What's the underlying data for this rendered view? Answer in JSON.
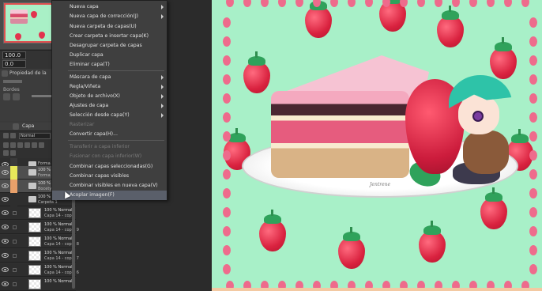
{
  "navigator": {
    "zoom_value": "100.0",
    "rotation_value": "0.0"
  },
  "properties": {
    "tab_label": "Propiedad de la",
    "expression_label": "Bordes"
  },
  "layers": {
    "tab_label": "Capa",
    "blend_mode": "Normal",
    "rows": [
      {
        "kind": "folder",
        "pct": "",
        "name": "Forma",
        "tag": "#3a3a3a"
      },
      {
        "kind": "folder",
        "pct": "100 %",
        "name": "Forma",
        "tag": "#e8e85a"
      },
      {
        "kind": "folder",
        "pct": "100 %",
        "name": "Bocety",
        "tag": "#e8a06a"
      },
      {
        "kind": "folder",
        "pct": "100 %",
        "name": "Carpeta 1",
        "tag": "#2e2e2e"
      },
      {
        "kind": "layer",
        "pct": "100 % Normal",
        "name": "Capa 14 - copia",
        "tag": "#2e2e2e"
      },
      {
        "kind": "layer",
        "pct": "100 % Normal",
        "name": "Capa 14 - copia 9",
        "tag": "#2e2e2e"
      },
      {
        "kind": "layer",
        "pct": "100 % Normal",
        "name": "Capa 14 - copia 8",
        "tag": "#2e2e2e"
      },
      {
        "kind": "layer",
        "pct": "100 % Normal",
        "name": "Capa 14 - copia 7",
        "tag": "#2e2e2e"
      },
      {
        "kind": "layer",
        "pct": "100 % Normal",
        "name": "Capa 14 - copia 6",
        "tag": "#2e2e2e"
      },
      {
        "kind": "layer",
        "pct": "100 % Normal",
        "name": "",
        "tag": "#2e2e2e"
      }
    ]
  },
  "menu": {
    "items": [
      {
        "label": "Nueva capa",
        "submenu": true,
        "disabled": false
      },
      {
        "label": "Nueva capa de corrección(J)",
        "submenu": true,
        "disabled": false
      },
      {
        "label": "Nueva carpeta de capas(U)",
        "submenu": false,
        "disabled": false
      },
      {
        "label": "Crear carpeta e insertar capa(K)",
        "submenu": false,
        "disabled": false
      },
      {
        "label": "Desagrupar carpeta de capas",
        "submenu": false,
        "disabled": false
      },
      {
        "label": "Duplicar capa",
        "submenu": false,
        "disabled": false
      },
      {
        "label": "Eliminar capa(T)",
        "submenu": false,
        "disabled": false
      },
      {
        "label": "Máscara de capa",
        "submenu": true,
        "disabled": false
      },
      {
        "label": "Regla/Viñeta",
        "submenu": true,
        "disabled": false
      },
      {
        "label": "Objeto de archivo(X)",
        "submenu": true,
        "disabled": false
      },
      {
        "label": "Ajustes de capa",
        "submenu": true,
        "disabled": false
      },
      {
        "label": "Selección desde capa(Y)",
        "submenu": true,
        "disabled": false
      },
      {
        "label": "Rasterizar",
        "submenu": false,
        "disabled": true
      },
      {
        "label": "Convertir capa(H)...",
        "submenu": false,
        "disabled": false
      },
      {
        "label": "Transferir a capa inferior",
        "submenu": false,
        "disabled": true
      },
      {
        "label": "Fusionar con capa inferior(W)",
        "submenu": false,
        "disabled": true
      },
      {
        "label": "Combinar capas seleccionadas(G)",
        "submenu": false,
        "disabled": false
      },
      {
        "label": "Combinar capas visibles",
        "submenu": false,
        "disabled": false
      },
      {
        "label": "Combinar visibles en nueva capa(V)",
        "submenu": false,
        "disabled": false
      },
      {
        "label": "Acoplar imagen(F)",
        "submenu": false,
        "disabled": false,
        "hover": true
      }
    ]
  },
  "canvas": {
    "signature": "Jentrene",
    "background_color": "#a8f0c8",
    "dot_color": "#ee6b8c"
  }
}
